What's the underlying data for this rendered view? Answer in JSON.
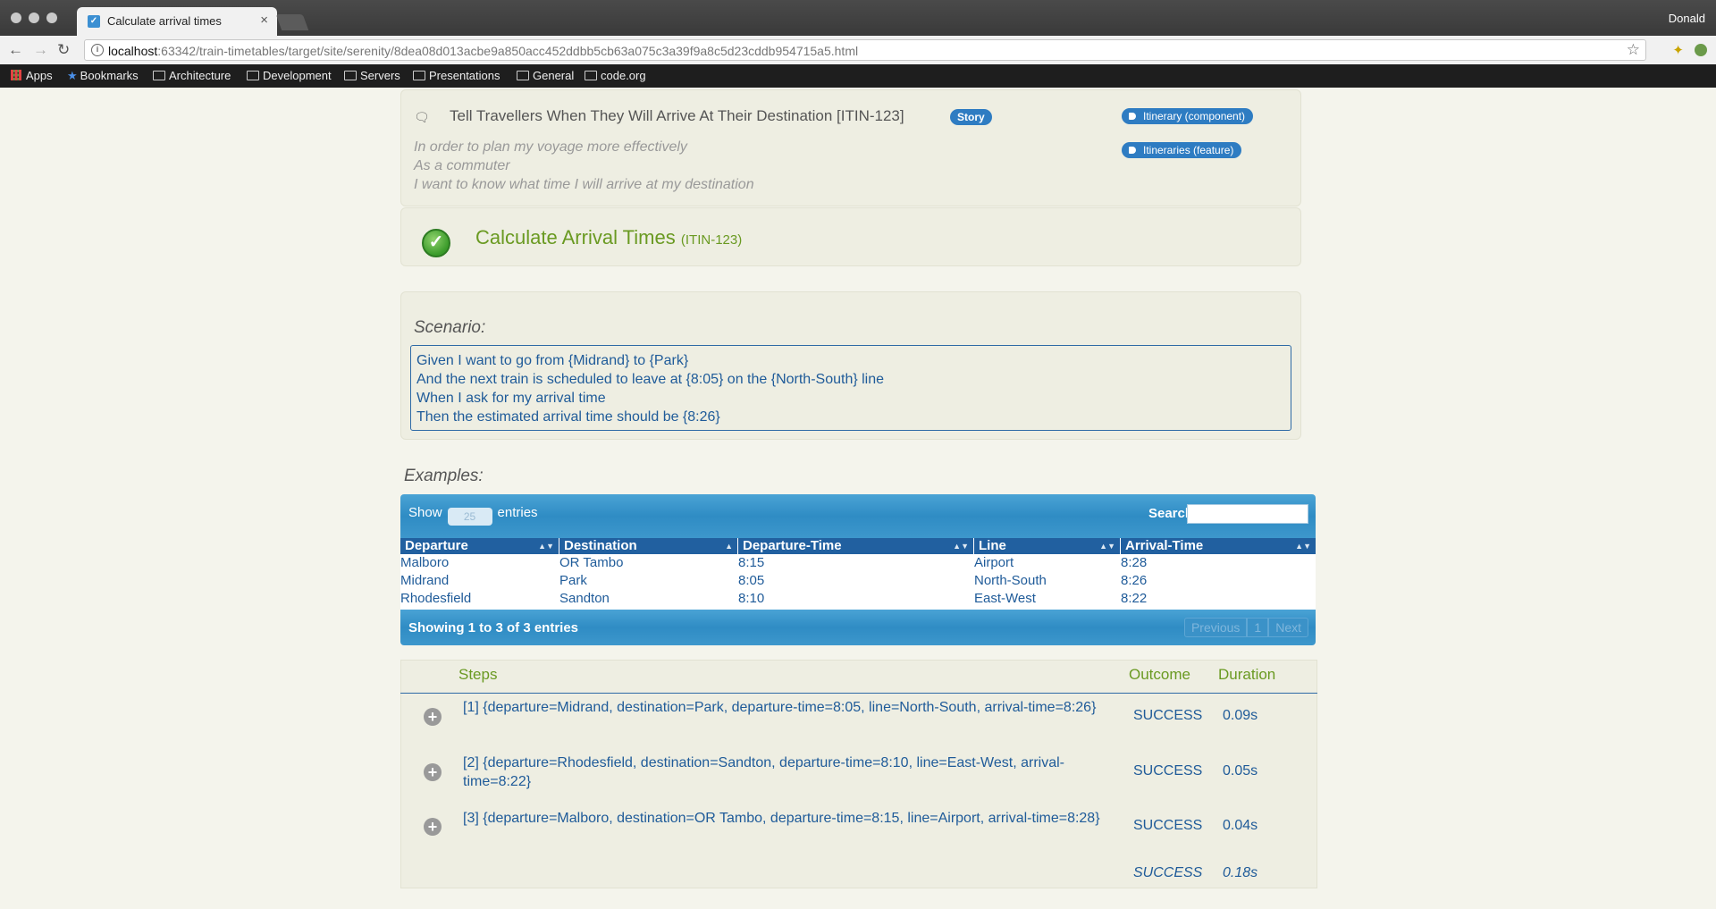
{
  "browser": {
    "tab_title": "Calculate arrival times",
    "tab_close": "×",
    "profile": "Donald",
    "url_host": "localhost",
    "url_rest": ":63342/train-timetables/target/site/serenity/8dea08d013acbe9a850acc452ddbb5cb63a075c3a39f9a8c5d23cddb954715a5.html",
    "bookmarks": [
      "Apps",
      "Bookmarks",
      "Architecture",
      "Development",
      "Servers",
      "Presentations",
      "General",
      "code.org"
    ]
  },
  "story": {
    "title": "Tell Travellers When They Will Arrive At Their Destination [ITIN-123]",
    "badge": "Story",
    "tags": [
      "Itinerary (component)",
      "Itineraries (feature)"
    ],
    "narrative": [
      "In order to plan my voyage more effectively",
      "As a commuter",
      "I want to know what time I will arrive at my destination"
    ]
  },
  "test": {
    "title": "Calculate Arrival Times",
    "issue": "(ITIN-123)",
    "status_icon": "check-icon"
  },
  "scenario": {
    "label": "Scenario:",
    "lines": [
      "Given I want to go from {Midrand} to {Park}",
      "And the next train is scheduled to leave at {8:05} on the {North-South} line",
      "When I ask for my arrival time",
      "Then the estimated arrival time should be {8:26}"
    ]
  },
  "examples": {
    "label": "Examples:",
    "show_label": "Show",
    "show_value": "25",
    "entries_label": "entries",
    "search_label": "Search:",
    "search_value": "",
    "columns": [
      "Departure",
      "Destination",
      "Departure-Time",
      "Line",
      "Arrival-Time"
    ],
    "rows": [
      [
        "Malboro",
        "OR Tambo",
        "8:15",
        "Airport",
        "8:28"
      ],
      [
        "Midrand",
        "Park",
        "8:05",
        "North-South",
        "8:26"
      ],
      [
        "Rhodesfield",
        "Sandton",
        "8:10",
        "East-West",
        "8:22"
      ]
    ],
    "info": "Showing 1 to 3 of 3 entries",
    "pager": [
      "Previous",
      "1",
      "Next"
    ]
  },
  "steps": {
    "headers": {
      "steps": "Steps",
      "outcome": "Outcome",
      "duration": "Duration"
    },
    "rows": [
      {
        "desc": "[1] {departure=Midrand, destination=Park, departure-time=8:05, line=North-South, arrival-time=8:26}",
        "outcome": "SUCCESS",
        "duration": "0.09s"
      },
      {
        "desc": "[2] {departure=Rhodesfield, destination=Sandton, departure-time=8:10, line=East-West, arrival-time=8:22}",
        "outcome": "SUCCESS",
        "duration": "0.05s"
      },
      {
        "desc": "[3] {departure=Malboro, destination=OR Tambo, departure-time=8:15, line=Airport, arrival-time=8:28}",
        "outcome": "SUCCESS",
        "duration": "0.04s"
      }
    ],
    "total_outcome": "SUCCESS",
    "total_duration": "0.18s"
  }
}
